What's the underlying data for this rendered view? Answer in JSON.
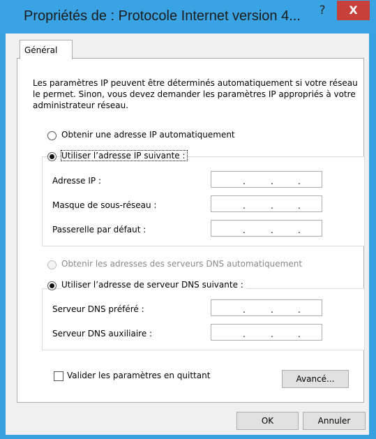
{
  "window": {
    "title": "Propriétés de : Protocole Internet version 4...",
    "help_symbol": "?",
    "close_symbol": "X"
  },
  "tab": {
    "label": "Général"
  },
  "description": "Les paramètres IP peuvent être déterminés automatiquement si votre réseau le permet. Sinon, vous devez demander les paramètres IP appropriés à votre administrateur réseau.",
  "ip_section": {
    "auto_option": "Obtenir une adresse IP automatiquement",
    "manual_option": "Utiliser l’adresse IP suivante :",
    "selected": "manual",
    "fields": [
      {
        "label": "Adresse IP :",
        "value": ". . ."
      },
      {
        "label": "Masque de sous-réseau :",
        "value": ". . ."
      },
      {
        "label": "Passerelle par défaut :",
        "value": ". . ."
      }
    ]
  },
  "dns_section": {
    "auto_option": "Obtenir les adresses des serveurs DNS automatiquement",
    "manual_option": "Utiliser l’adresse de serveur DNS suivante :",
    "selected": "manual",
    "auto_disabled": true,
    "fields": [
      {
        "label": "Serveur DNS préféré :",
        "value": ". . ."
      },
      {
        "label": "Serveur DNS auxiliaire :",
        "value": ". . ."
      }
    ]
  },
  "validate": {
    "label": "Valider les paramètres en quittant",
    "checked": false
  },
  "buttons": {
    "advanced": "Avancé...",
    "ok": "OK",
    "cancel": "Annuler"
  },
  "colors": {
    "titlebar": "#3aa3e3",
    "close_button": "#c7403a",
    "client_background": "#f0f0f0"
  }
}
